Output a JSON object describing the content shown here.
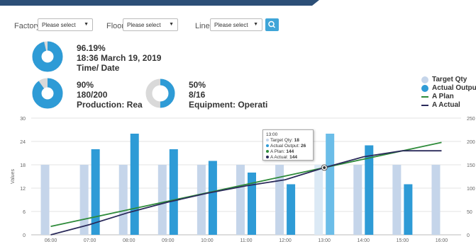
{
  "filters": {
    "factory_label": "Factory",
    "factory_value": "Please select",
    "floor_label": "Floor",
    "floor_value": "Please select",
    "line_label": "Line",
    "line_value": "Please select",
    "search_icon": "search-icon"
  },
  "kpis": {
    "overall": {
      "percent": "96.19%",
      "datetime": "18:36 March 19, 2019",
      "label": "Time/ Date",
      "fraction": 0.9619
    },
    "production": {
      "percent": "90%",
      "counts": "180/200",
      "label": "Production: Rea",
      "fraction": 0.9
    },
    "equipment": {
      "percent": "50%",
      "counts": "8/16",
      "label": "Equipment: Operati",
      "fraction": 0.5
    }
  },
  "legend": [
    {
      "name": "Target Qty",
      "kind": "dot",
      "color": "#c5d5ea"
    },
    {
      "name": "Actual Output",
      "kind": "dot",
      "color": "#2e9bd6"
    },
    {
      "name": "A Plan",
      "kind": "line",
      "color": "#2e8b3a"
    },
    {
      "name": "A Actual",
      "kind": "line",
      "color": "#2a2a5a"
    }
  ],
  "tooltip": {
    "time": "13:00",
    "target": "Target Qty: ",
    "target_val": "18",
    "actual": "Actual Output: ",
    "actual_val": "26",
    "plan": "A Plan: ",
    "plan_val": "144",
    "aactual": "A Actual: ",
    "aactual_val": "144"
  },
  "chart_data": {
    "type": "bar",
    "categories": [
      "06:00",
      "07:00",
      "08:00",
      "09:00",
      "10:00",
      "11:00",
      "12:00",
      "13:00",
      "14:00",
      "15:00",
      "16:00"
    ],
    "series": [
      {
        "name": "Target Qty",
        "type": "bar",
        "axis": "left",
        "color": "#c5d5ea",
        "values": [
          18,
          18,
          18,
          18,
          18,
          18,
          18,
          18,
          18,
          18,
          18
        ]
      },
      {
        "name": "Actual Output",
        "type": "bar",
        "axis": "left",
        "color": "#2e9bd6",
        "values": [
          null,
          22,
          26,
          22,
          19,
          16,
          13,
          26,
          23,
          13,
          null
        ]
      },
      {
        "name": "A Plan",
        "type": "line",
        "axis": "right",
        "color": "#2e8b3a",
        "values": [
          18,
          36,
          54,
          72,
          90,
          108,
          126,
          144,
          162,
          180,
          198
        ]
      },
      {
        "name": "A Actual",
        "type": "line",
        "axis": "right",
        "color": "#2a2a5a",
        "values": [
          0,
          22,
          48,
          70,
          89,
          105,
          118,
          144,
          167,
          180,
          180
        ]
      }
    ],
    "ylabel": "Values",
    "ylim": [
      0,
      30
    ],
    "y_ticks": [
      0,
      6,
      12,
      18,
      24,
      30
    ],
    "y2lim": [
      0,
      250
    ],
    "y2_ticks": [
      0,
      50,
      100,
      150,
      200,
      250
    ],
    "grid": true,
    "highlight_category": "13:00"
  }
}
